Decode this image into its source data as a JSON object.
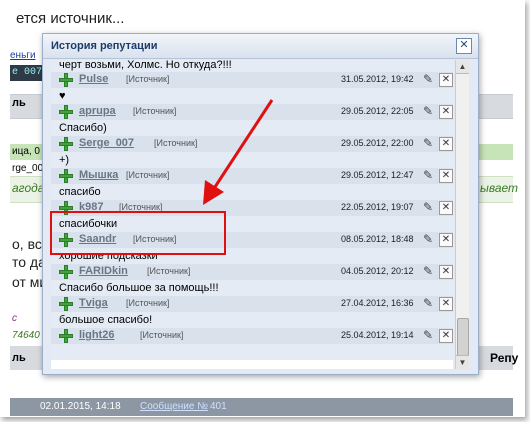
{
  "background": {
    "top_text": "ется источник...",
    "link1": "еньги",
    "dark_box": "e 007",
    "left_word1": "ль",
    "green_text1": "ица, 0",
    "green_text2": "rge_00",
    "italic_text1": "агодар",
    "italic_text2": "ывает",
    "left_text1": "о, всё",
    "left_text2": "то дав",
    "left_text3": "от ми",
    "purple_text": "с",
    "purple_num": "74640",
    "left_word2": "ль",
    "right_word": "Репу",
    "bottom_text": "02.01.2015, 14:18",
    "bottom_link": "Сообщение №",
    "bottom_num": "401"
  },
  "popup": {
    "title": "История репутации",
    "close_label": "✕",
    "top_partial_comment": "черт возьми, Холмс. Но откуда?!!!",
    "source_label": "[Источник]",
    "entries": [
      {
        "user": "Pulse",
        "date": "31.05.2012, 19:42",
        "comment": "♥"
      },
      {
        "user": "aprupa",
        "date": "29.05.2012, 22:05",
        "comment": "Спасибо)"
      },
      {
        "user": "Serge_007",
        "date": "29.05.2012, 22:00",
        "comment": "+)"
      },
      {
        "user": "Мышка",
        "date": "29.05.2012, 12:47",
        "comment": "спасибо"
      },
      {
        "user": "k987",
        "date": "22.05.2012, 19:07",
        "comment": "спасибочки"
      },
      {
        "user": "Saandr",
        "date": "08.05.2012, 18:48",
        "comment": "хорошие подсказки"
      },
      {
        "user": "FARIDkin",
        "date": "04.05.2012, 20:12",
        "comment": "Спасибо большое за помощь!!!"
      },
      {
        "user": "Tviga",
        "date": "27.04.2012, 16:36",
        "comment": "большое спасибо!"
      },
      {
        "user": "light26",
        "date": "25.04.2012, 19:14",
        "comment": ""
      }
    ]
  },
  "colors": {
    "highlight": "#e01010",
    "arrow": "#e01010",
    "plus": "#3fa43a"
  }
}
